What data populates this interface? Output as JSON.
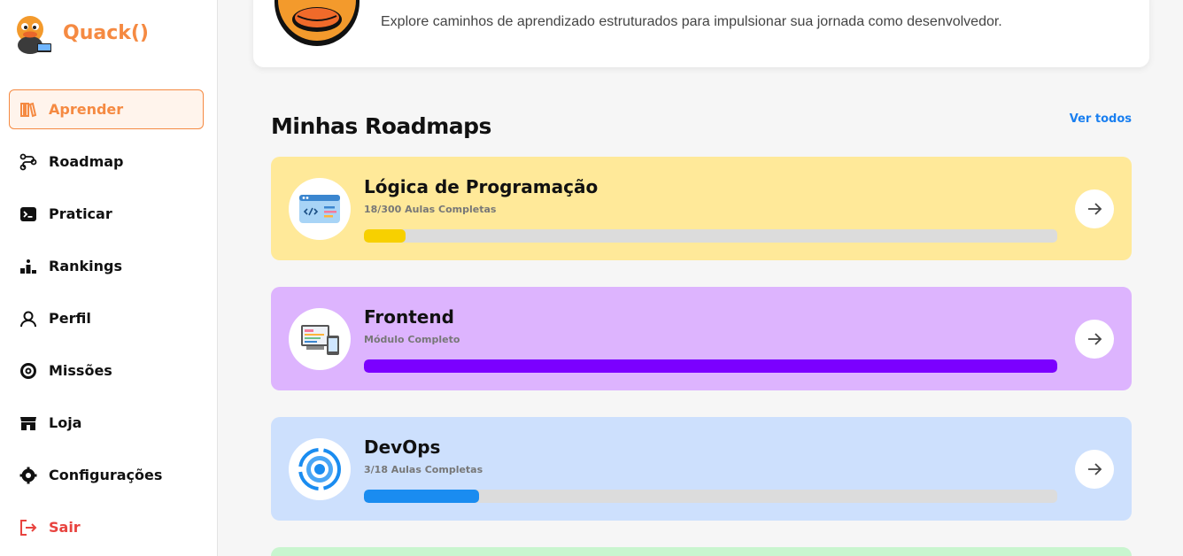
{
  "brand": {
    "name": "Quack()"
  },
  "sidebar": {
    "items": [
      {
        "label": "Aprender",
        "icon": "books-icon",
        "active": true
      },
      {
        "label": "Roadmap",
        "icon": "roadmap-icon"
      },
      {
        "label": "Praticar",
        "icon": "terminal-icon"
      },
      {
        "label": "Rankings",
        "icon": "podium-icon"
      },
      {
        "label": "Perfil",
        "icon": "user-icon"
      },
      {
        "label": "Missões",
        "icon": "target-icon"
      },
      {
        "label": "Loja",
        "icon": "store-icon"
      },
      {
        "label": "Configurações",
        "icon": "gear-icon"
      },
      {
        "label": "Sair",
        "icon": "logout-icon"
      }
    ]
  },
  "hero": {
    "description": "Explore caminhos de aprendizado estruturados para impulsionar sua jornada como desenvolvedor."
  },
  "roadmaps": {
    "title": "Minhas Roadmaps",
    "see_all": "Ver todos",
    "cards": [
      {
        "title": "Lógica de Programação",
        "subtitle": "18/300 Aulas Completas",
        "progress": 0.06,
        "bg": "#ffe999",
        "fill": "#f7d000",
        "icon": "code-window-icon"
      },
      {
        "title": "Frontend",
        "subtitle": "Módulo Completo",
        "progress": 1.0,
        "bg": "#ddb4fe",
        "fill": "#7b00ff",
        "icon": "devices-icon"
      },
      {
        "title": "DevOps",
        "subtitle": "3/18 Aulas Completas",
        "progress": 0.166,
        "bg": "#cde0fd",
        "fill": "#1a8cf0",
        "icon": "cycle-gear-icon"
      }
    ]
  },
  "colors": {
    "accent": "#f58a42",
    "link": "#1a7ff0",
    "danger": "#e8433f"
  }
}
